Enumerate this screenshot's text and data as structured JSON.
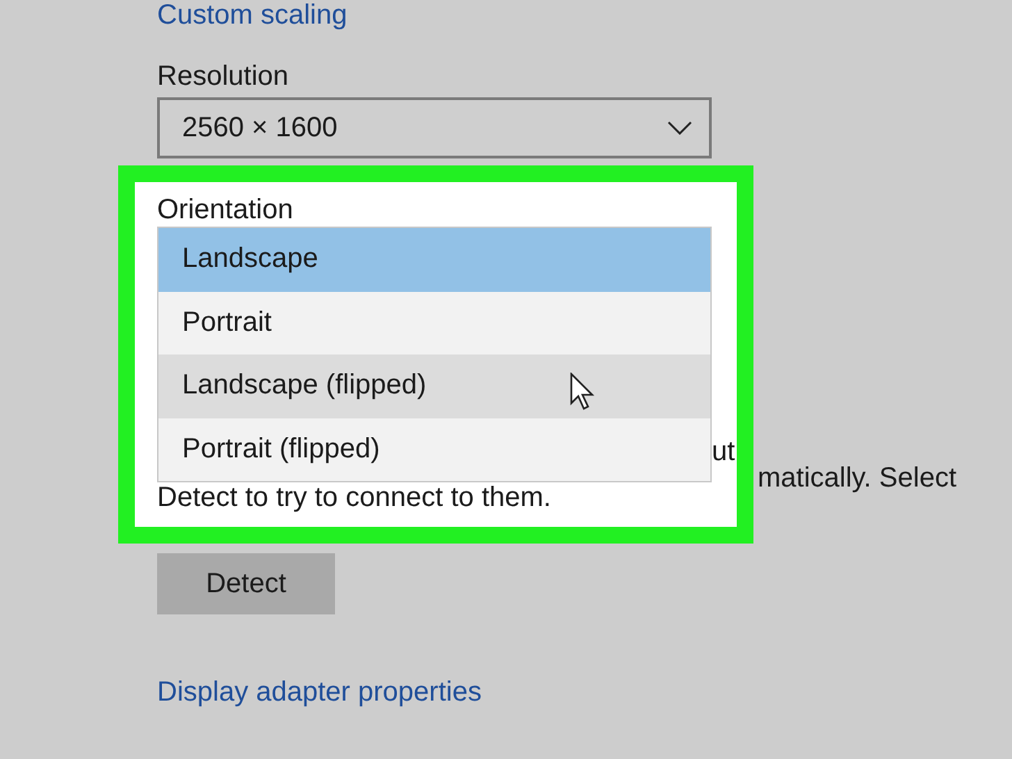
{
  "custom_scaling_link": "Custom scaling",
  "resolution": {
    "label": "Resolution",
    "value": "2560 × 1600"
  },
  "orientation": {
    "label": "Orientation",
    "options": [
      {
        "label": "Landscape",
        "selected": true,
        "hovered": false
      },
      {
        "label": "Portrait",
        "selected": false,
        "hovered": false
      },
      {
        "label": "Landscape (flipped)",
        "selected": false,
        "hovered": true
      },
      {
        "label": "Portrait (flipped)",
        "selected": false,
        "hovered": false
      }
    ]
  },
  "partly_hidden_text": {
    "inside_highlight": "ut",
    "outside_highlight": "matically. Select",
    "next_line": "Detect to try to connect to them."
  },
  "detect_button": "Detect",
  "adapter_link": "Display adapter properties"
}
